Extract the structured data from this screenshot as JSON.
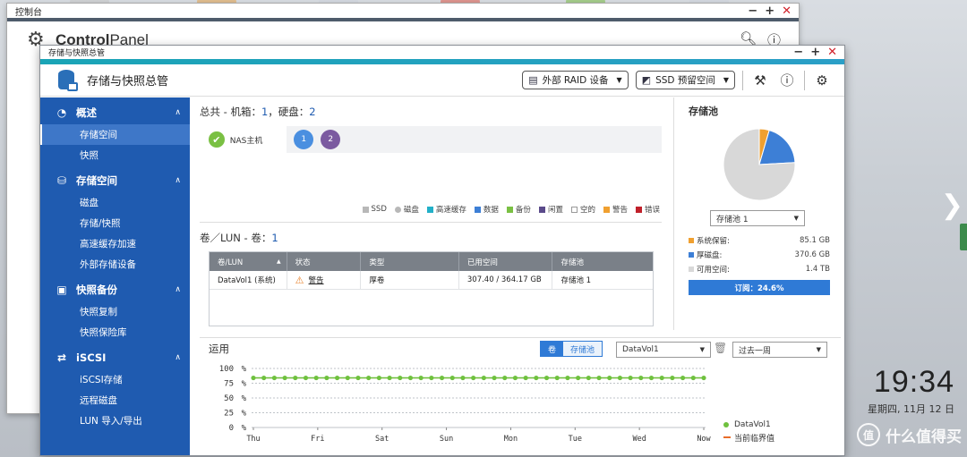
{
  "back_window": {
    "title": "控制台",
    "app_title_a": "Control",
    "app_title_b": "Panel"
  },
  "front_window": {
    "title": "存储与快照总管",
    "app_title": "存储与快照总管",
    "header_buttons": {
      "raid_label": "外部 RAID 设备",
      "ssd_label": "SSD 预留空间"
    }
  },
  "sidebar": {
    "sections": [
      {
        "label": "概述",
        "icon": "dashboard-icon",
        "items": [
          "存储空间",
          "快照"
        ]
      },
      {
        "label": "存储空间",
        "icon": "database-icon",
        "items": [
          "磁盘",
          "存储/快照",
          "高速缓存加速",
          "外部存储设备"
        ]
      },
      {
        "label": "快照备份",
        "icon": "snapshot-icon",
        "items": [
          "快照复制",
          "快照保险库"
        ]
      },
      {
        "label": "iSCSI",
        "icon": "iscsi-icon",
        "items": [
          "iSCSI存储",
          "远程磁盘",
          "LUN 导入/导出"
        ]
      }
    ],
    "active_item": "存储空间"
  },
  "summary": {
    "label": "总共",
    "detail_a": " - 机箱：",
    "enclosures": "1",
    "detail_b": "，硬盘：",
    "disks": "2",
    "nas_label": "NAS主机",
    "disk_slots": [
      {
        "num": "1",
        "color": "#4a8fe0"
      },
      {
        "num": "2",
        "color": "#7b5aa0"
      }
    ],
    "legend": [
      {
        "label": "SSD",
        "color": "#b8b8b8",
        "shape": "square"
      },
      {
        "label": "磁盘",
        "color": "#b8b8b8",
        "shape": "round"
      },
      {
        "label": "高速缓存",
        "color": "#22b0c8",
        "shape": "square"
      },
      {
        "label": "数据",
        "color": "#3d7fd6",
        "shape": "square"
      },
      {
        "label": "备份",
        "color": "#7ac043",
        "shape": "square"
      },
      {
        "label": "闲置",
        "color": "#5a4a8a",
        "shape": "square"
      },
      {
        "label": "空的",
        "color": "#ffffff",
        "shape": "square"
      },
      {
        "label": "警告",
        "color": "#f0a030",
        "shape": "square"
      },
      {
        "label": "错误",
        "color": "#c0202a",
        "shape": "square"
      }
    ]
  },
  "volumes": {
    "title": "卷／LUN",
    "detail": " - 卷：",
    "count": "1",
    "columns": [
      "卷/LUN",
      "状态",
      "类型",
      "已用空间",
      "存储池"
    ],
    "rows": [
      {
        "name": "DataVol1 (系统)",
        "status": "警告",
        "type": "厚卷",
        "used": "307.40 / 364.17 GB",
        "pool": "存储池 1"
      }
    ]
  },
  "pool": {
    "title": "存储池",
    "selected": "存储池 1",
    "legend": [
      {
        "label": "系统保留:",
        "value": "85.1 GB",
        "color": "#f0a030"
      },
      {
        "label": "厚磁盘:",
        "value": "370.6 GB",
        "color": "#3d7fd6"
      },
      {
        "label": "可用空间:",
        "value": "1.4 TB",
        "color": "#d8d8d8"
      }
    ],
    "subscription": "订阅：24.6%",
    "pie_colors": [
      "#f0a030",
      "#3d7fd6",
      "#d8d8d8"
    ]
  },
  "usage": {
    "title": "运用",
    "tab_volume": "卷",
    "tab_pool": "存储池",
    "volume_select": "DataVol1",
    "period_select": "过去一周",
    "legend_series": "DataVol1",
    "legend_threshold": "当前临界值"
  },
  "chart_data": {
    "type": "line",
    "x": [
      "Thu",
      "Fri",
      "Sat",
      "Sun",
      "Mon",
      "Tue",
      "Wed",
      "Now"
    ],
    "yticks": [
      "100",
      "75",
      "50",
      "25",
      "0"
    ],
    "yunit": "%",
    "ylim": [
      0,
      100
    ],
    "series": [
      {
        "name": "DataVol1",
        "color": "#6fc13e",
        "value": 84,
        "points": 44
      }
    ],
    "threshold": {
      "name": "当前临界值",
      "value": 84,
      "color": "#e86d2a"
    },
    "grid": true
  },
  "desktop": {
    "time": "19:34",
    "date": "星期四, 11月 12 日",
    "watermark": "什么值得买",
    "watermark_icon": "值"
  }
}
